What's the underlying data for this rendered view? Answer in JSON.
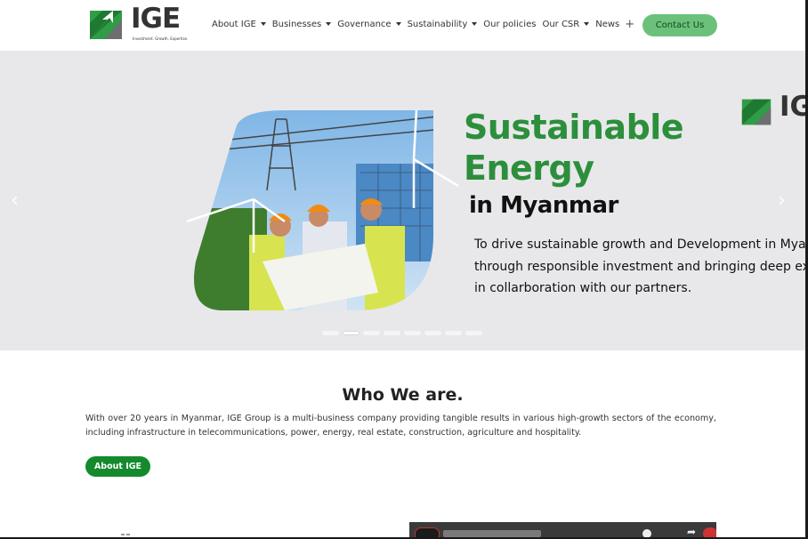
{
  "header": {
    "logo_text": "IGE",
    "logo_tagline": "Investment. Growth. Expertise.",
    "nav": [
      {
        "label": "About IGE",
        "caret": true
      },
      {
        "label": "Businesses",
        "caret": true
      },
      {
        "label": "Governance",
        "caret": true
      },
      {
        "label": "Sustainability",
        "caret": true
      },
      {
        "label": "Our policies",
        "caret": false
      },
      {
        "label": "Our CSR",
        "caret": true
      },
      {
        "label": "News",
        "caret": false,
        "plus": true
      }
    ],
    "contact_label": "Contact Us"
  },
  "hero": {
    "title_line1": "Sustainable",
    "title_line2": "Energy",
    "subtitle": "in Myanmar",
    "desc_line1": "To drive sustainable growth and Development in Mya",
    "desc_line2": "through responsible investment and bringing deep expe",
    "desc_line3": "in collarboration with our partners.",
    "logo_text": "IGE",
    "prev_icon": "‹",
    "next_icon": "›",
    "slide_count": 8,
    "active_slide": 2
  },
  "who": {
    "title": "Who We are.",
    "text": "With over 20 years in Myanmar, IGE Group  is a multi-business company providing tangible results in various high-growth sectors of the economy, including infrastructure in telecommunications, power, energy, real estate, construction, agriculture and hospitality.",
    "button_label": "About IGE"
  },
  "colors": {
    "brand_green": "#2c8f3c",
    "button_green": "#148a2d",
    "contact_green": "#6cc17a",
    "hero_bg": "#e8e8ea"
  }
}
